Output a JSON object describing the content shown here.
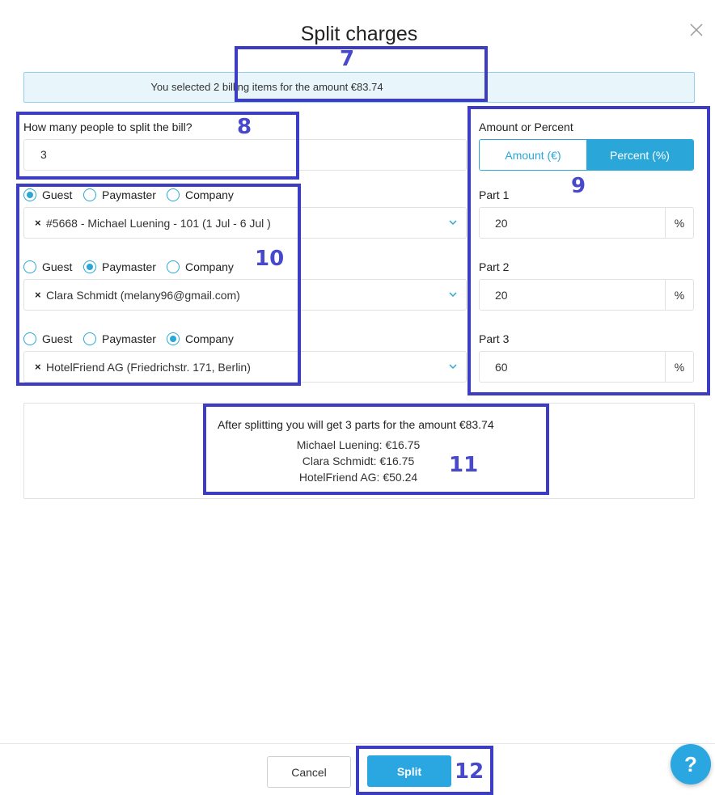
{
  "dialog": {
    "title": "Split charges",
    "info_text": "You selected 2 billing items for the amount €83.74"
  },
  "people": {
    "label": "How many people to split the bill?",
    "value": "3"
  },
  "parts": [
    {
      "options": [
        "Guest",
        "Paymaster",
        "Company"
      ],
      "selected": "Guest",
      "selection_text": "#5668 - Michael Luening - 101 (1 Jul - 6 Jul )"
    },
    {
      "options": [
        "Guest",
        "Paymaster",
        "Company"
      ],
      "selected": "Paymaster",
      "selection_text": "Clara Schmidt (melany96@gmail.com)"
    },
    {
      "options": [
        "Guest",
        "Paymaster",
        "Company"
      ],
      "selected": "Company",
      "selection_text": "HotelFriend AG (Friedrichstr. 171, Berlin)"
    }
  ],
  "mode": {
    "label": "Amount or Percent",
    "amount_label": "Amount (€)",
    "percent_label": "Percent (%)",
    "selected": "percent"
  },
  "part_values": [
    {
      "label": "Part 1",
      "value": "20",
      "suffix": "%"
    },
    {
      "label": "Part 2",
      "value": "20",
      "suffix": "%"
    },
    {
      "label": "Part 3",
      "value": "60",
      "suffix": "%"
    }
  ],
  "summary": {
    "heading": "After splitting you will get 3 parts for the amount €83.74",
    "lines": [
      "Michael Luening: €16.75",
      "Clara Schmidt: €16.75",
      "HotelFriend AG: €50.24"
    ]
  },
  "annotations": [
    "7",
    "8",
    "9",
    "10",
    "11",
    "12"
  ],
  "footer": {
    "cancel_label": "Cancel",
    "split_label": "Split",
    "help_label": "?"
  },
  "colors": {
    "accent": "#2aa7e0",
    "annotation": "#3d3dc4",
    "info_bg": "#e8f5fb"
  }
}
